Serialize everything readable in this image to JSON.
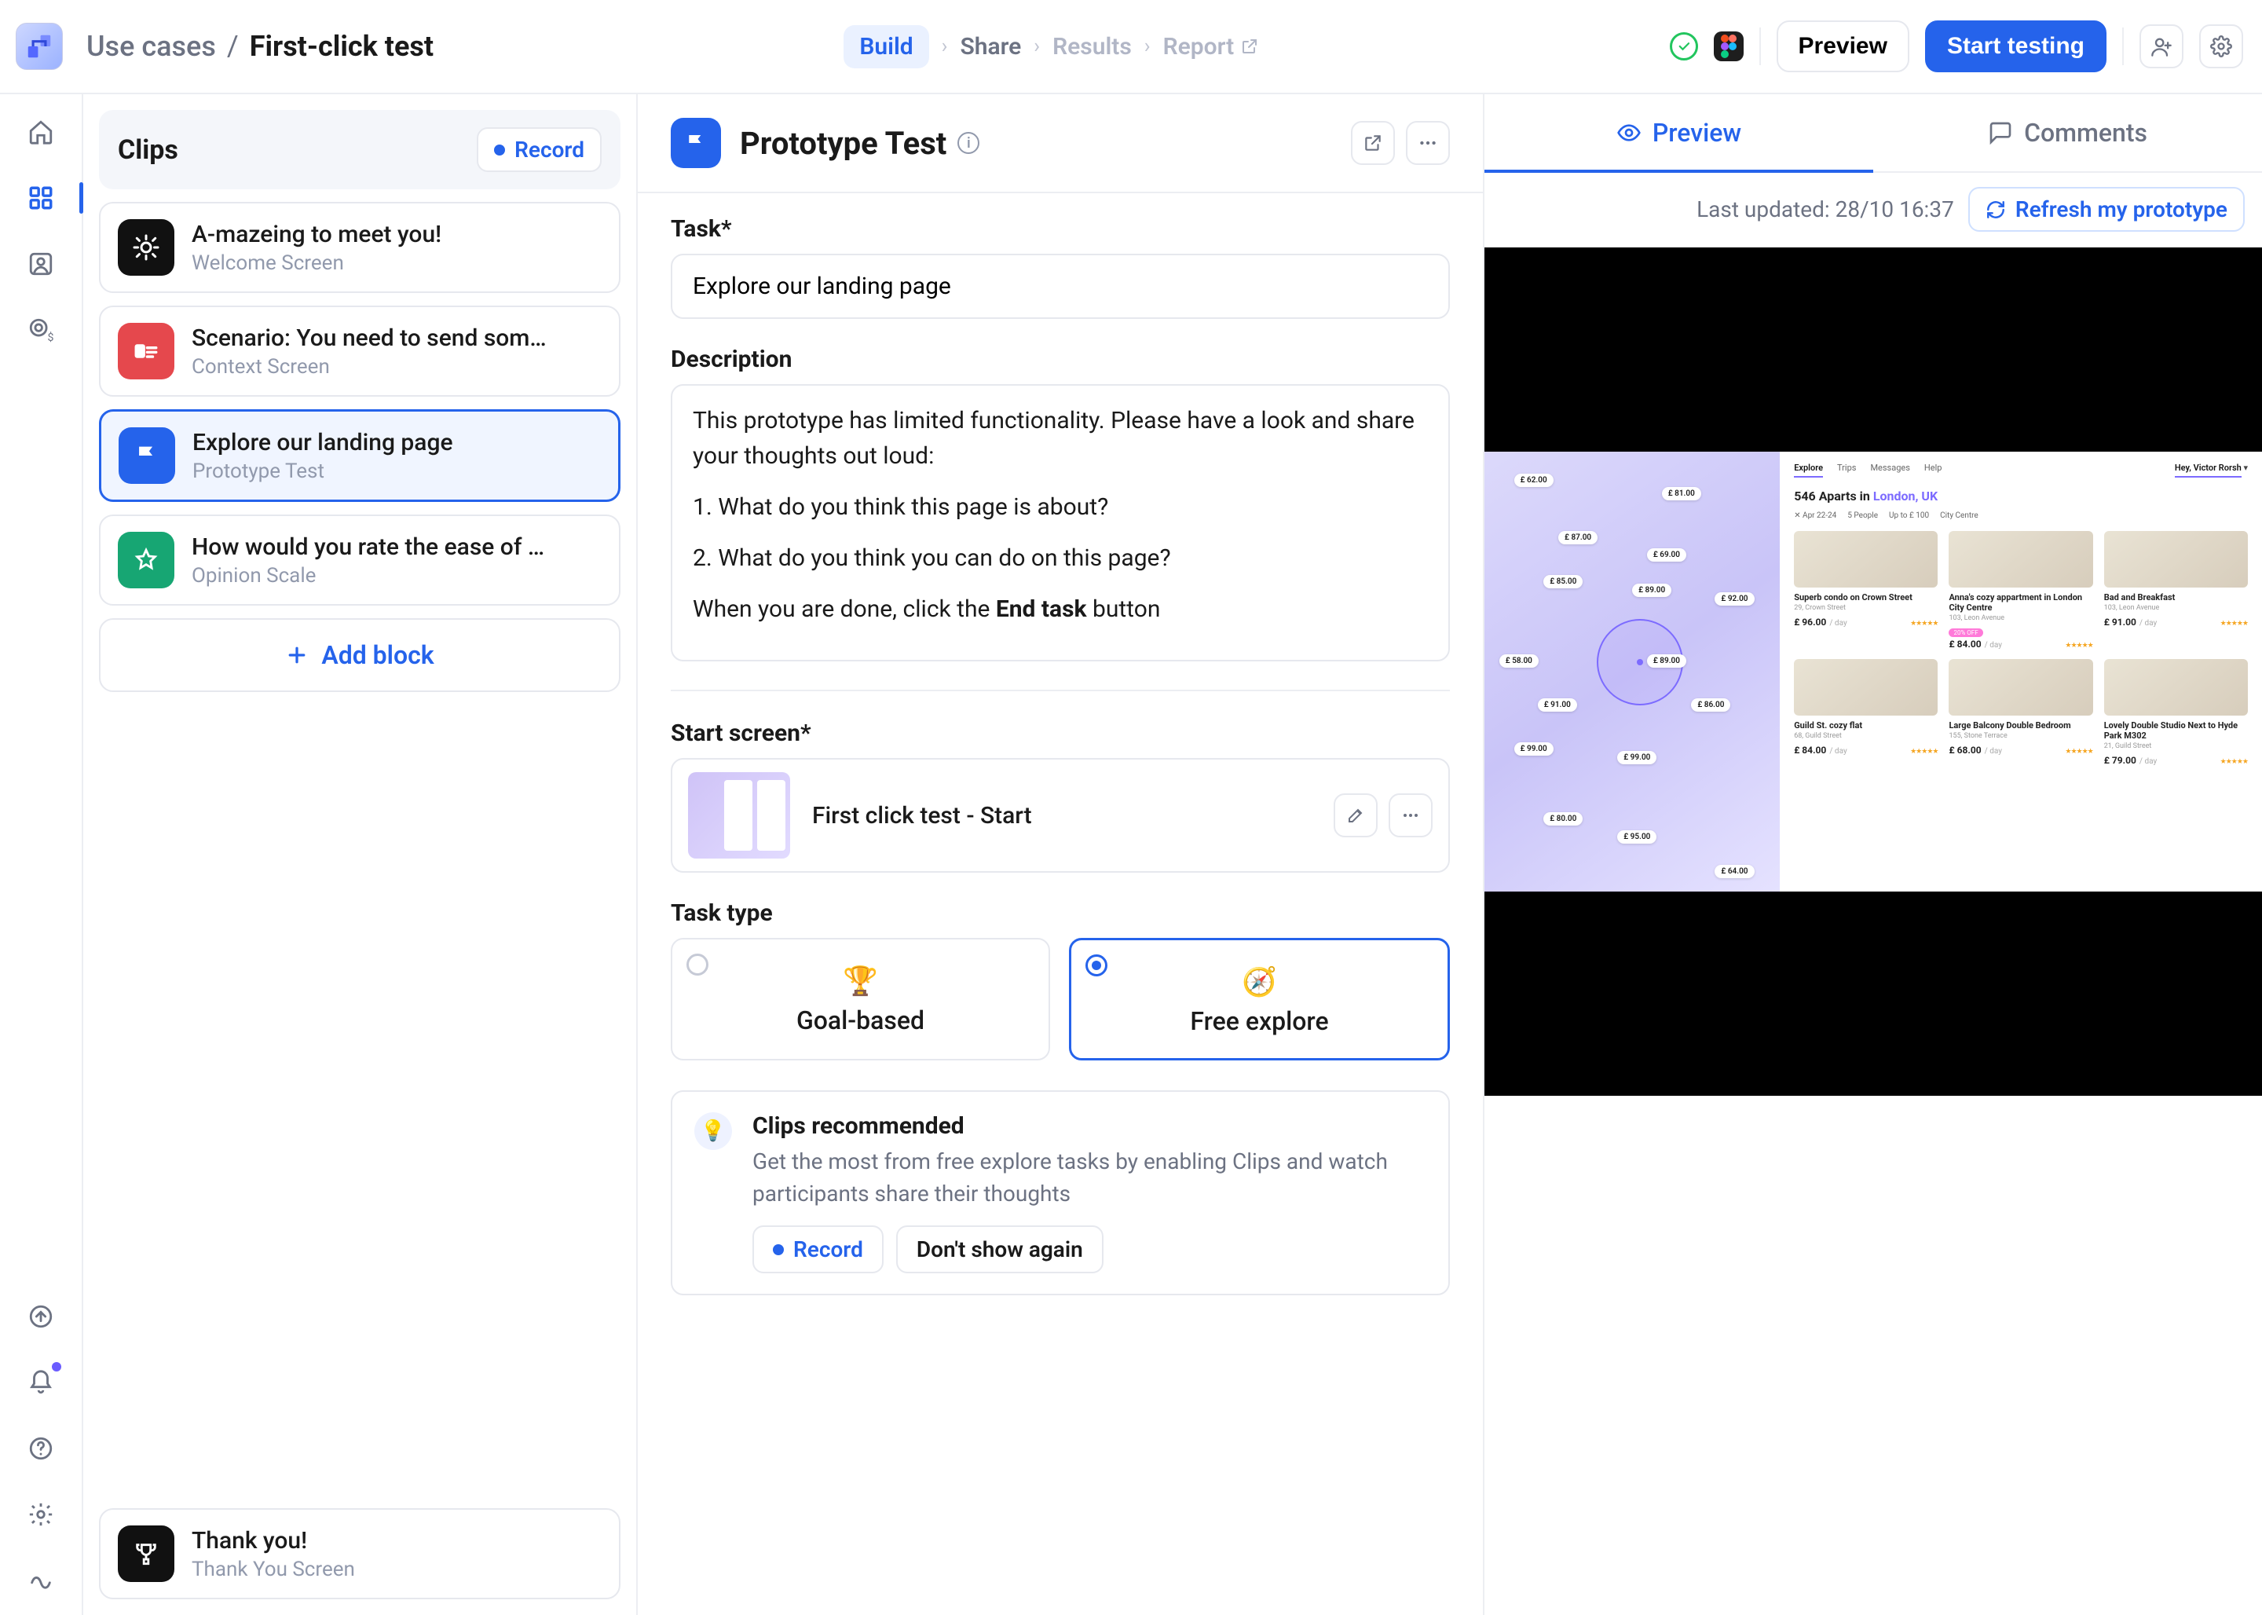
{
  "colors": {
    "primary": "#2563eb",
    "border": "#e6e8ee",
    "muted": "#6c7282"
  },
  "breadcrumb": {
    "parent": "Use cases",
    "current": "First-click test"
  },
  "steps": [
    "Build",
    "Share",
    "Results",
    "Report"
  ],
  "topbar": {
    "preview_label": "Preview",
    "start_label": "Start testing"
  },
  "clips": {
    "title": "Clips",
    "record_label": "Record",
    "add_block_label": "Add block",
    "blocks": [
      {
        "title": "A-mazeing to meet you!",
        "sub": "Welcome Screen"
      },
      {
        "title": "Scenario: You need to send som…",
        "sub": "Context Screen"
      },
      {
        "title": "Explore our landing page",
        "sub": "Prototype Test"
      },
      {
        "title": "How would you rate the ease of …",
        "sub": "Opinion Scale"
      }
    ],
    "footer_block": {
      "title": "Thank you!",
      "sub": "Thank You Screen"
    }
  },
  "editor": {
    "title": "Prototype Test",
    "task_label": "Task*",
    "task_value": "Explore our landing page",
    "description_label": "Description",
    "description_lines": {
      "l1": "This prototype has limited functionality. Please have a look and share your thoughts out loud:",
      "l2": "1. What do you think this page is about?",
      "l3": "2. What do you think you can do on this page?",
      "l4_pre": "When you are done, click the ",
      "l4_bold": "End task",
      "l4_post": " button"
    },
    "start_screen_label": "Start screen*",
    "start_screen_name": "First click test - Start",
    "task_type_label": "Task type",
    "task_types": {
      "goal": "Goal-based",
      "free": "Free explore"
    },
    "tip": {
      "title": "Clips recommended",
      "text": "Get the most from free explore tasks by enabling Clips and watch participants share their thoughts",
      "record_label": "Record",
      "dismiss_label": "Don't show again"
    }
  },
  "preview": {
    "tab_preview": "Preview",
    "tab_comments": "Comments",
    "last_updated": "Last updated: 28/10 16:37",
    "refresh_label": "Refresh my prototype"
  },
  "prototype": {
    "nav": [
      "Explore",
      "Trips",
      "Messages",
      "Help"
    ],
    "user_greeting": "Hey, Victor Rorsh",
    "count": "546",
    "title_prefix": "Aparts in ",
    "location": "London, UK",
    "filters": [
      "Apr 22-24",
      "5 People",
      "Up to £ 100",
      "City Centre"
    ],
    "map_prices": [
      "£ 62.00",
      "£ 81.00",
      "£ 87.00",
      "£ 69.00",
      "£ 85.00",
      "£ 89.00",
      "£ 92.00",
      "£ 58.00",
      "£ 89.00",
      "£ 91.00",
      "£ 86.00",
      "£ 99.00",
      "£ 99.00",
      "£ 80.00",
      "£ 95.00",
      "£ 64.00"
    ],
    "listings": [
      {
        "name": "Superb condo on Crown Street",
        "addr": "29, Crown Street",
        "price": "£ 96.00"
      },
      {
        "name": "Anna's cozy appartment in London City Centre",
        "addr": "103, Leon Avenue",
        "price": "£ 84.00",
        "tag": "20% OFF"
      },
      {
        "name": "Bad and Breakfast",
        "addr": "103, Leon Avenue",
        "price": "£ 91.00"
      },
      {
        "name": "Guild St. cozy flat",
        "addr": "68, Guild Street",
        "price": "£ 84.00"
      },
      {
        "name": "Large Balcony Double Bedroom",
        "addr": "155, Stone Terrace",
        "price": "£ 68.00"
      },
      {
        "name": "Lovely Double Studio Next to Hyde Park M302",
        "addr": "21, Guild Street",
        "price": "£ 79.00"
      }
    ]
  }
}
